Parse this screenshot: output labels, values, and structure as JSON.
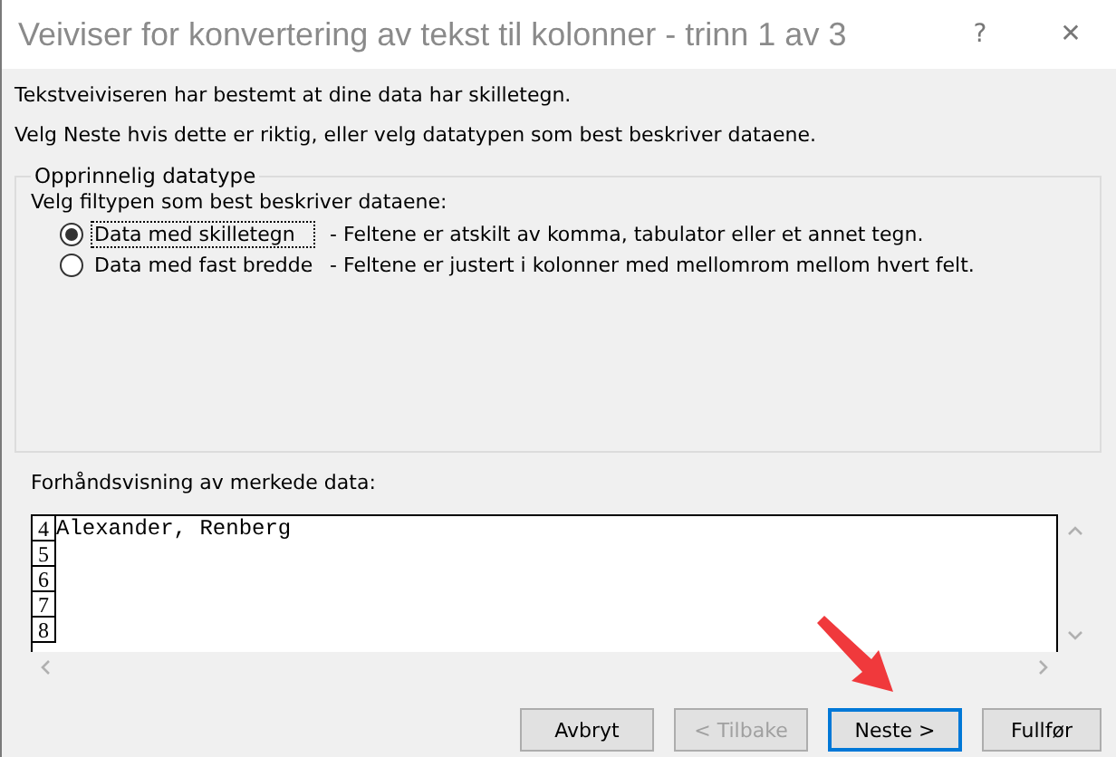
{
  "window": {
    "title": "Veiviser for konvertering av tekst til kolonner - trinn 1 av 3",
    "help": "?",
    "close": "✕"
  },
  "intro": [
    "Tekstveiviseren har bestemt at dine data har skilletegn.",
    "Velg Neste hvis dette er riktig, eller velg datatypen som best beskriver dataene."
  ],
  "group": {
    "title": "Opprinnelig datatype",
    "prompt": "Velg filtypen som best beskriver dataene:",
    "options": [
      {
        "label": "Data med skilletegn",
        "description": "- Feltene er atskilt av komma, tabulator eller et annet tegn.",
        "selected": true
      },
      {
        "label": "Data med fast bredde",
        "description": "- Feltene er justert i kolonner med mellomrom mellom hvert felt.",
        "selected": false
      }
    ]
  },
  "preview": {
    "label": "Forhåndsvisning av merkede data:",
    "rows": [
      {
        "number": "4",
        "text": "Alexander, Renberg"
      },
      {
        "number": "5",
        "text": ""
      },
      {
        "number": "6",
        "text": ""
      },
      {
        "number": "7",
        "text": ""
      },
      {
        "number": "8",
        "text": ""
      }
    ]
  },
  "buttons": [
    {
      "label": "Avbryt",
      "disabled": false,
      "default": false
    },
    {
      "label": "< Tilbake",
      "disabled": true,
      "default": false
    },
    {
      "label": "Neste >",
      "disabled": false,
      "default": true
    },
    {
      "label": "Fullfør",
      "disabled": false,
      "default": false
    }
  ]
}
